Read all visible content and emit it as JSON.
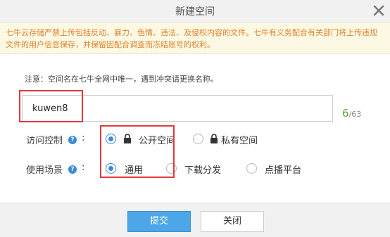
{
  "dialog": {
    "title": "新建空间",
    "close_icon": "close-icon"
  },
  "notice": {
    "text": "七牛云存储严禁上传包括反动、暴力、色情、违法、及侵权内容的文件。七牛有义务配合有关部门将上传违规文件的用户信息保存，并保留因配合调查而冻结账号的权利。",
    "color": "#e0822b",
    "background": "#fcf8e3"
  },
  "name_field": {
    "hint": "注意：空间名在七牛全网中唯一，遇到冲突请更换名称。",
    "value": "kuwen8",
    "char_count": "6",
    "char_max": "/63"
  },
  "access_control": {
    "label": "访问控制",
    "help_icon": "help-icon",
    "colon": ":",
    "options": [
      {
        "label": "公开空间",
        "icon": "lock-icon",
        "checked": true
      },
      {
        "label": "私有空间",
        "icon": "lock-icon",
        "checked": false
      }
    ]
  },
  "usage_scene": {
    "label": "使用场景",
    "help_icon": "help-icon",
    "colon": ":",
    "options": [
      {
        "label": "通用",
        "checked": true
      },
      {
        "label": "下载分发",
        "checked": false
      },
      {
        "label": "点播平台",
        "checked": false
      }
    ]
  },
  "footer": {
    "submit_label": "提交",
    "close_label": "关闭"
  },
  "colors": {
    "accent": "#3b8ad9",
    "highlight_box": "#e03a3e",
    "count_ok": "#5aa832",
    "primary_button": "#4ca6e8"
  }
}
